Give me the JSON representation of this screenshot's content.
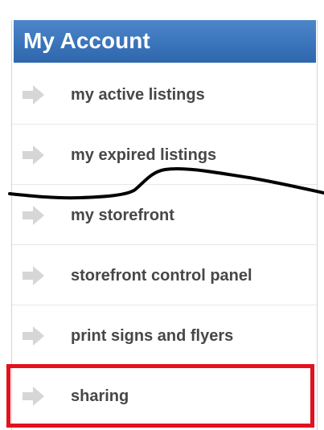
{
  "panel": {
    "title": "My Account"
  },
  "menu": {
    "items": [
      {
        "label": "my active listings",
        "icon": "arrow-right-icon"
      },
      {
        "label": "my expired listings",
        "icon": "arrow-right-icon"
      },
      {
        "label": "my storefront",
        "icon": "arrow-right-icon"
      },
      {
        "label": "storefront control panel",
        "icon": "arrow-right-icon"
      },
      {
        "label": "print signs and flyers",
        "icon": "arrow-right-icon"
      },
      {
        "label": "sharing",
        "icon": "arrow-right-icon"
      }
    ]
  },
  "colors": {
    "header": "#3a74ba",
    "label": "#474747",
    "arrow": "#d6d6d6",
    "highlight": "#e2121e",
    "scribble": "#000000"
  }
}
